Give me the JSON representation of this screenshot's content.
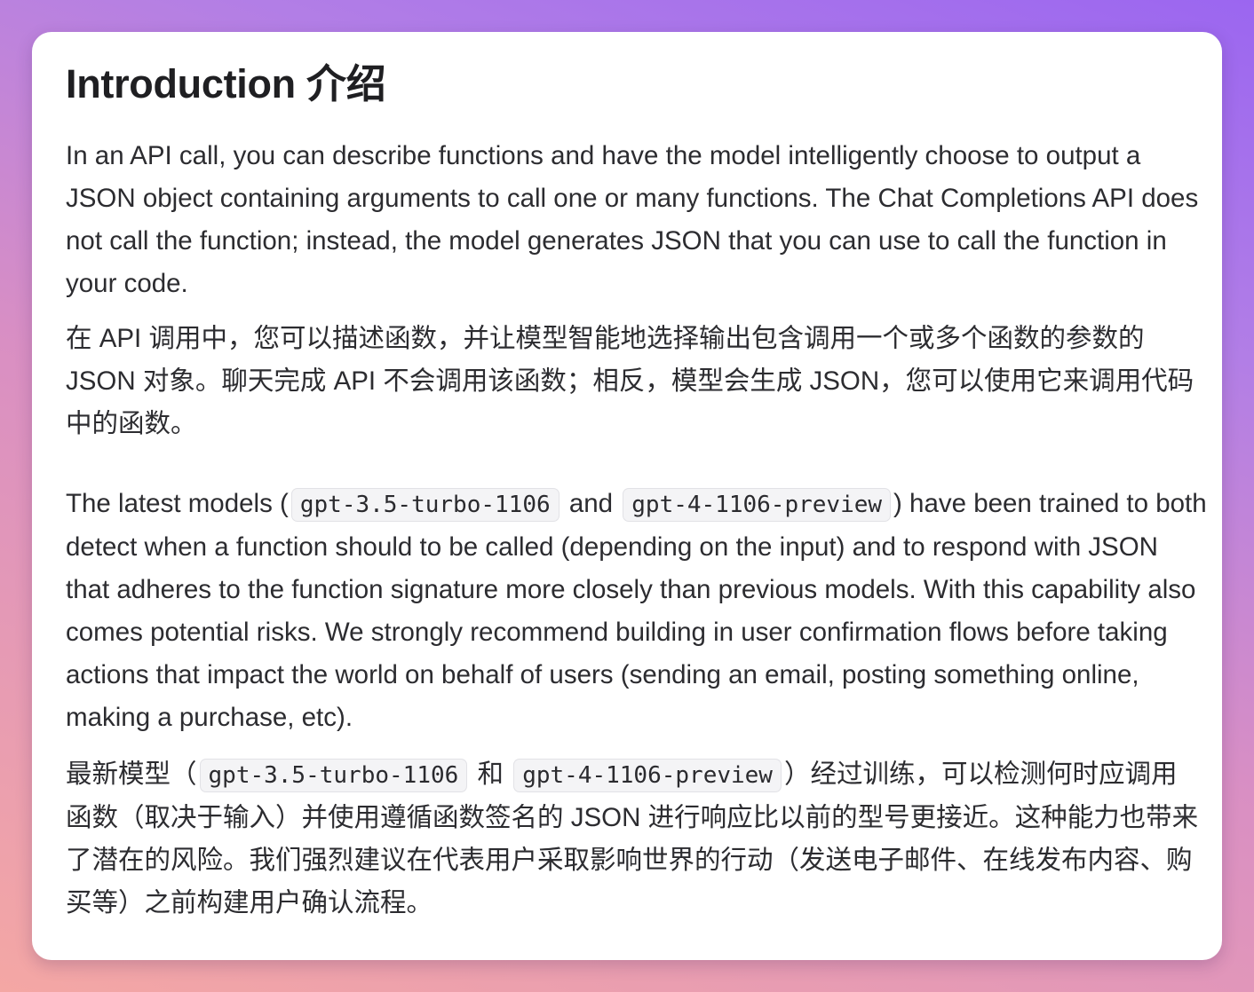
{
  "title": "Introduction 介绍",
  "para1_en": "In an API call, you can describe functions and have the model intelligently choose to output a JSON object containing arguments to call one or many functions. The Chat Completions API does not call the function; instead, the model generates JSON that you can use to call the function in your code.",
  "para1_zh": "在 API 调用中，您可以描述函数，并让模型智能地选择输出包含调用一个或多个函数的参数的 JSON 对象。聊天完成 API 不会调用该函数；相反，模型会生成 JSON，您可以使用它来调用代码中的函数。",
  "para2_en": {
    "before": "The latest models (",
    "code1": "gpt-3.5-turbo-1106",
    "middle": "and",
    "code2": "gpt-4-1106-preview",
    "after": ") have been trained to both detect when a function should to be called (depending on the input) and to respond with JSON that adheres to the function signature more closely than previous models. With this capability also comes potential risks. We strongly recommend building in user confirmation flows before taking actions that impact the world on behalf of users (sending an email, posting something online, making a purchase, etc)."
  },
  "para2_zh": {
    "before": "最新模型（",
    "code1": "gpt-3.5-turbo-1106",
    "middle": "和",
    "code2": "gpt-4-1106-preview",
    "after": "）经过训练，可以检测何时应调用函数（取决于输入）并使用遵循函数签名的 JSON 进行响应比以前的型号更接近。这种能力也带来了潜在的风险。我们强烈建议在代表用户采取影响世界的行动（发送电子邮件、在线发布内容、购买等）之前构建用户确认流程。"
  }
}
